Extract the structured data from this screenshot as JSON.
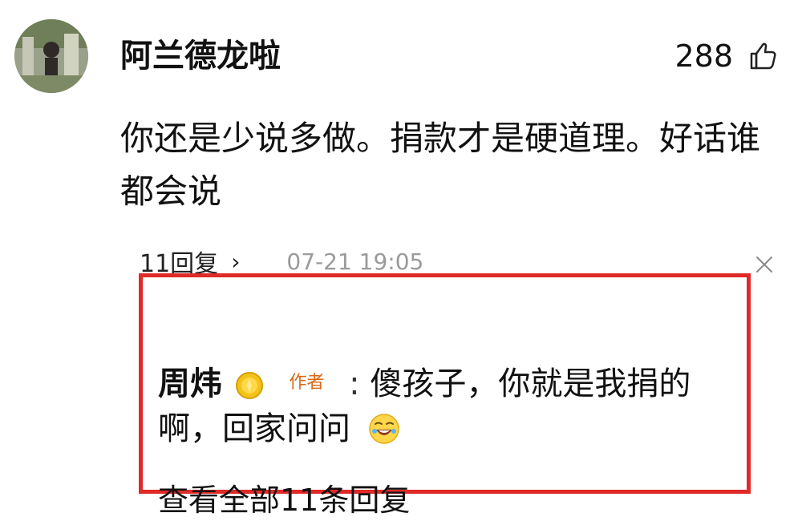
{
  "comment": {
    "username": "阿兰德龙啦",
    "likes": "288",
    "text": "你还是少说多做。捐款才是硬道理。好话谁都会说"
  },
  "replies_meta": {
    "count_label": "11回复",
    "chevron": "›",
    "timestamp": "07-21 19:05"
  },
  "reply": {
    "author": "周炜",
    "badge": "作者",
    "separator": ":",
    "text_line1": "傻孩子，你就是我捐的",
    "text_line2": "啊，回家问问"
  },
  "footer": {
    "view_all": "查看全部11条回复"
  },
  "icons": {
    "avatar": "user-avatar",
    "like": "thumb-up-icon",
    "close": "close-icon",
    "coin": "gold-coin-icon",
    "laugh": "laughing-emoji-icon"
  },
  "colors": {
    "highlight_border": "#e02a27",
    "author_badge": "#d86818"
  }
}
